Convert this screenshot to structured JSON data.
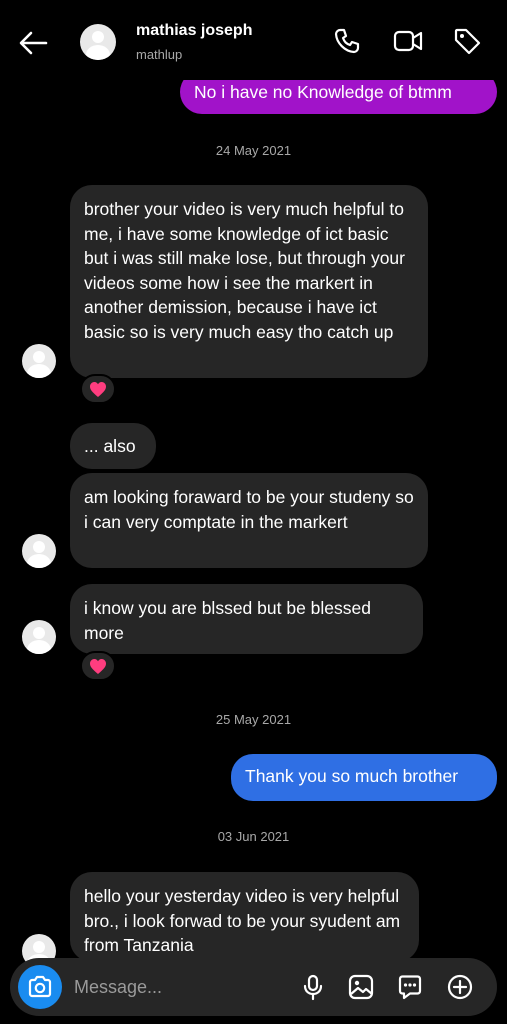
{
  "header": {
    "name": "mathias joseph",
    "handle": "mathlup"
  },
  "messages": {
    "m1": "No i have no Knowledge of btmm",
    "date1": "24 May 2021",
    "m2": "brother your video is very much helpful to me, i have some knowledge of ict basic but i was still make lose, but through your videos some how i see the markert in another demission, because i have ict basic so is very much easy tho catch up",
    "m2_reaction": "❤️",
    "m3": "... also",
    "m4": "am looking foraward to be your studeny so i can very comptate in the markert",
    "m5": "i know you are blssed but be blessed more",
    "m5_reaction": "❤️",
    "date2": "25 May 2021",
    "m6": "Thank you so much brother",
    "date3": "03 Jun 2021",
    "m7": "hello your yesterday video is very helpful bro.,  i look forwad to be your syudent am from Tanzania"
  },
  "composer": {
    "placeholder": "Message..."
  },
  "icons": {
    "back": "arrow-left-icon",
    "phone": "phone-icon",
    "video": "video-camera-icon",
    "tag": "tag-icon",
    "camera": "camera-icon",
    "mic": "microphone-icon",
    "gallery": "image-icon",
    "sticker": "chat-sticker-icon",
    "plus": "plus-circle-icon"
  },
  "colors": {
    "background": "#000000",
    "incoming_bubble": "#262626",
    "outgoing_purple": "#a113c9",
    "outgoing_blue": "#2f6fe4",
    "camera_button": "#1a8cf0"
  }
}
